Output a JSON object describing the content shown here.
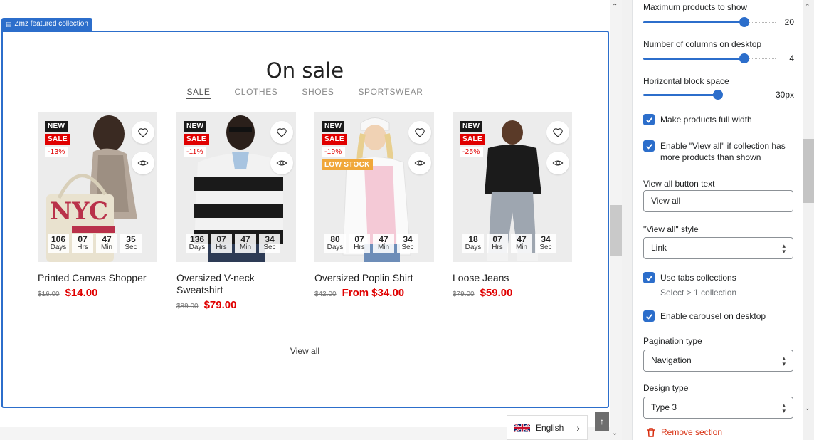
{
  "preview": {
    "section_tag": "Zmz featured collection",
    "heading": "On sale",
    "tabs": [
      {
        "label": "SALE",
        "active": true
      },
      {
        "label": "CLOTHES",
        "active": false
      },
      {
        "label": "SHOES",
        "active": false
      },
      {
        "label": "SPORTSWEAR",
        "active": false
      }
    ],
    "products": [
      {
        "title": "Printed Canvas Shopper",
        "old_price": "$16.00",
        "price": "$14.00",
        "badges": [
          "NEW",
          "SALE",
          "-13%"
        ],
        "countdown": {
          "days": "106",
          "hrs": "07",
          "min": "47",
          "sec": "35"
        }
      },
      {
        "title": "Oversized V-neck Sweatshirt",
        "old_price": "$89.00",
        "price": "$79.00",
        "badges": [
          "NEW",
          "SALE",
          "-11%"
        ],
        "countdown": {
          "days": "136",
          "hrs": "07",
          "min": "47",
          "sec": "34"
        }
      },
      {
        "title": "Oversized Poplin Shirt",
        "old_price": "$42.00",
        "price": "From $34.00",
        "badges": [
          "NEW",
          "SALE",
          "-19%",
          "LOW STOCK"
        ],
        "countdown": {
          "days": "80",
          "hrs": "07",
          "min": "47",
          "sec": "34"
        }
      },
      {
        "title": "Loose Jeans",
        "old_price": "$79.00",
        "price": "$59.00",
        "badges": [
          "NEW",
          "SALE",
          "-25%"
        ],
        "countdown": {
          "days": "18",
          "hrs": "07",
          "min": "47",
          "sec": "34"
        }
      }
    ],
    "countdown_units": {
      "days": "Days",
      "hrs": "Hrs",
      "min": "Min",
      "sec": "Sec"
    },
    "view_all": "View all",
    "language": "English",
    "icons": {
      "wishlist": "heart-icon",
      "quick_view": "eye-icon",
      "prev": "arrow-left-icon",
      "next": "arrow-right-icon",
      "flag": "uk-flag-icon",
      "back_to_top": "arrow-up-icon"
    }
  },
  "settings": {
    "max_products": {
      "label": "Maximum products to show",
      "value": "20",
      "fraction": 0.8
    },
    "columns_desktop": {
      "label": "Number of columns on desktop",
      "value": "4",
      "fraction": 0.8
    },
    "block_space": {
      "label": "Horizontal block space",
      "value": "30px",
      "fraction": 0.6
    },
    "full_width": {
      "label": "Make products full width",
      "checked": true
    },
    "enable_view_all": {
      "label": "Enable \"View all\" if collection has more products than shown",
      "checked": true
    },
    "view_all_text": {
      "label": "View all button text",
      "value": "View all"
    },
    "view_all_style": {
      "label": "\"View all\" style",
      "value": "Link"
    },
    "use_tabs": {
      "label": "Use tabs collections",
      "checked": true,
      "hint": "Select > 1 collection"
    },
    "enable_carousel": {
      "label": "Enable carousel on desktop",
      "checked": true
    },
    "pagination_type": {
      "label": "Pagination type",
      "value": "Navigation"
    },
    "design_type": {
      "label": "Design type",
      "value": "Type 3"
    },
    "remove_section": "Remove section"
  },
  "colors": {
    "accent": "#2c6ecb",
    "sale_red": "#e00000",
    "danger": "#d72c0d",
    "low_stock": "#f0a73a"
  }
}
